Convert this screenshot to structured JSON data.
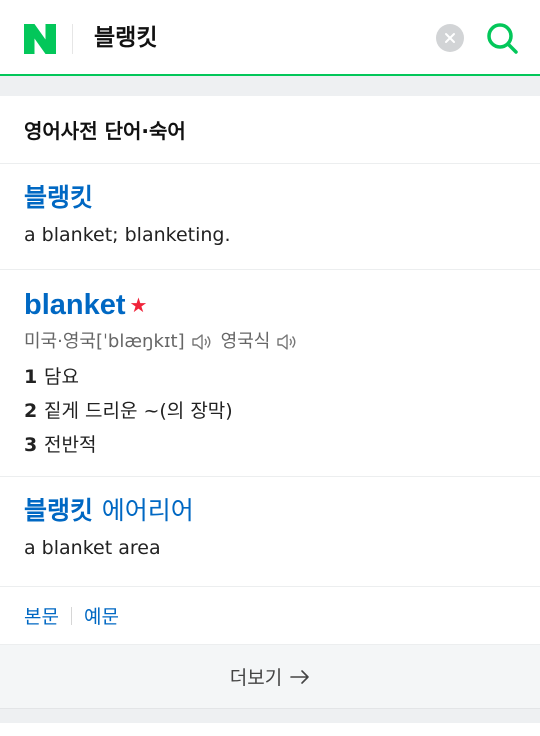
{
  "header": {
    "query": "블랭킷",
    "logo_color": "#03c75a",
    "accent": "#03c75a"
  },
  "section": {
    "title": "영어사전 단어·숙어"
  },
  "entries": [
    {
      "headword": "블랭킷",
      "meaning": "a blanket; blanketing."
    },
    {
      "headword": "blanket",
      "star": "★",
      "pron_us_uk": "미국·영국[ˈblæŋkɪt]",
      "pron_uk": "영국식",
      "defs": [
        {
          "num": "1",
          "text": "담요"
        },
        {
          "num": "2",
          "text": "짙게 드리운 ~(의 장막)"
        },
        {
          "num": "3",
          "text": "전반적"
        }
      ]
    },
    {
      "headword_main": "블랭킷",
      "headword_rest": "에어리어",
      "meaning": "a blanket area"
    }
  ],
  "tabs": [
    "본문",
    "예문"
  ],
  "more_label": "더보기",
  "colors": {
    "link": "#0068c3",
    "star": "#f0243a"
  }
}
